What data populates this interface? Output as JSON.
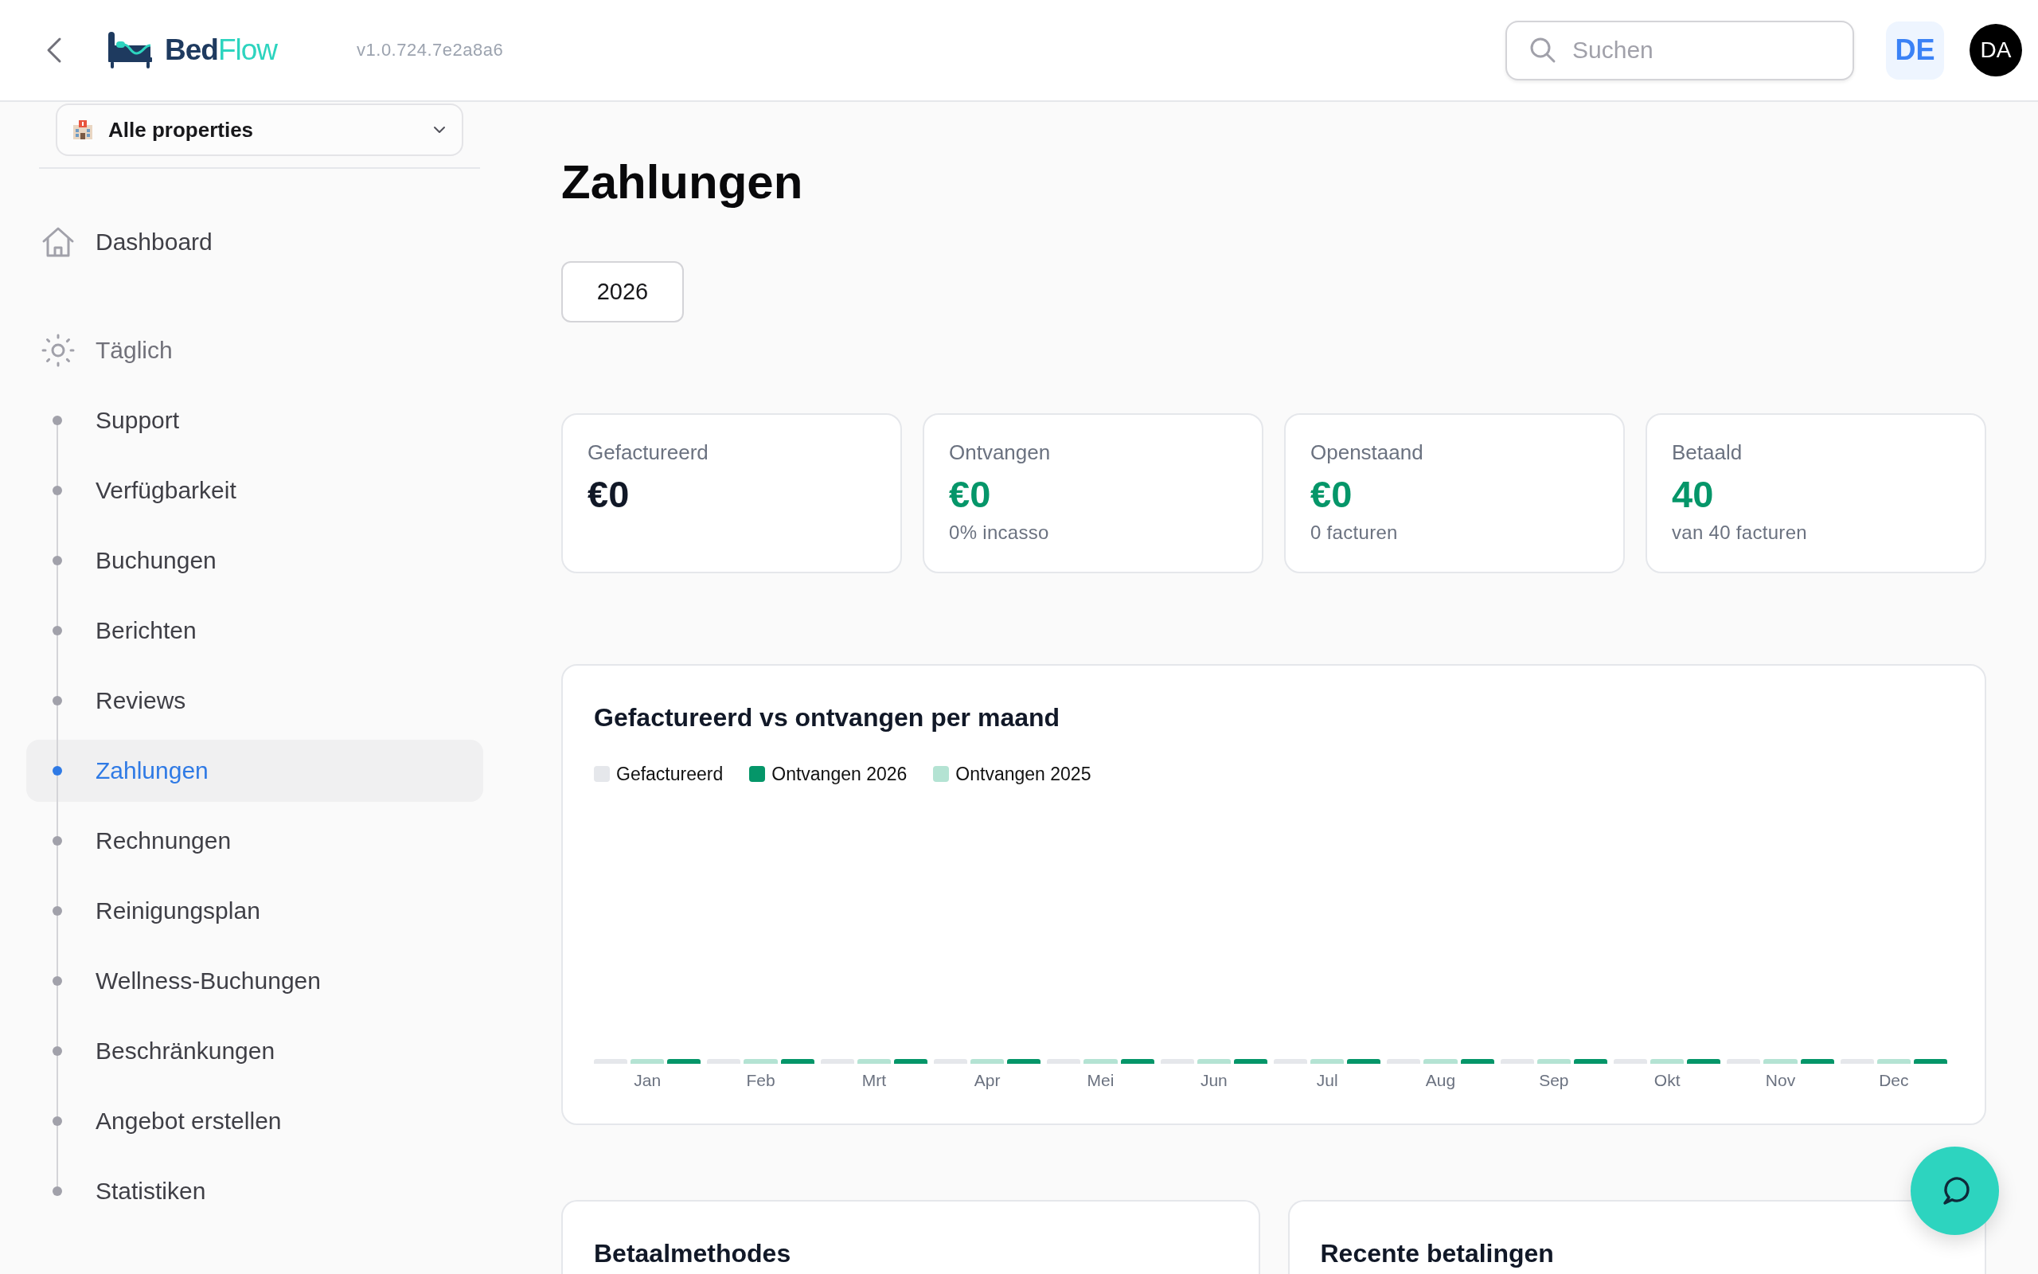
{
  "header": {
    "brand": [
      "Bed",
      "Flow"
    ],
    "version": "v1.0.724.7e2a8a6",
    "search": {
      "placeholder": "Suchen"
    },
    "language": "DE",
    "avatar": "DA"
  },
  "sidebar": {
    "property_selector": {
      "value": "Alle properties"
    },
    "items": [
      {
        "kind": "link",
        "label": "Dashboard",
        "selected": false
      },
      {
        "kind": "group",
        "label": "Täglich",
        "selected": false,
        "children": [
          {
            "label": "Support",
            "selected": false
          },
          {
            "label": "Verfügbarkeit",
            "selected": false
          },
          {
            "label": "Buchungen",
            "selected": false
          },
          {
            "label": "Berichten",
            "selected": false
          },
          {
            "label": "Reviews",
            "selected": false
          },
          {
            "label": "Zahlungen",
            "selected": true
          },
          {
            "label": "Rechnungen",
            "selected": false
          },
          {
            "label": "Reinigungsplan",
            "selected": false
          },
          {
            "label": "Wellness-Buchungen",
            "selected": false
          },
          {
            "label": "Beschränkungen",
            "selected": false
          },
          {
            "label": "Angebot erstellen",
            "selected": false
          },
          {
            "label": "Statistiken",
            "selected": false
          }
        ]
      }
    ]
  },
  "page": {
    "title": "Zahlungen",
    "year": "2026",
    "stats": [
      {
        "label": "Gefactureerd",
        "value": "€0",
        "color": "#111827"
      },
      {
        "label": "Ontvangen",
        "value": "€0",
        "color": "#059669",
        "note": "0% incasso"
      },
      {
        "label": "Openstaand",
        "value": "€0",
        "color": "#059669",
        "note": "0 facturen"
      },
      {
        "label": "Betaald",
        "value": "40",
        "color": "#059669",
        "note": "van 40 facturen"
      }
    ],
    "chart": {
      "title": "Gefactureerd vs ontvangen per maand",
      "legend": [
        {
          "label": "Gefactureerd",
          "color": "#e5e7eb"
        },
        {
          "label": "Ontvangen 2026",
          "color": "#059669"
        },
        {
          "label": "Ontvangen 2025",
          "color": "#b4e3d3"
        }
      ],
      "months": [
        "Jan",
        "Feb",
        "Mrt",
        "Apr",
        "Mei",
        "Jun",
        "Jul",
        "Aug",
        "Sep",
        "Okt",
        "Nov",
        "Dec"
      ]
    },
    "panels": [
      {
        "title": "Betaalmethodes"
      },
      {
        "title": "Recente betalingen"
      }
    ]
  }
}
